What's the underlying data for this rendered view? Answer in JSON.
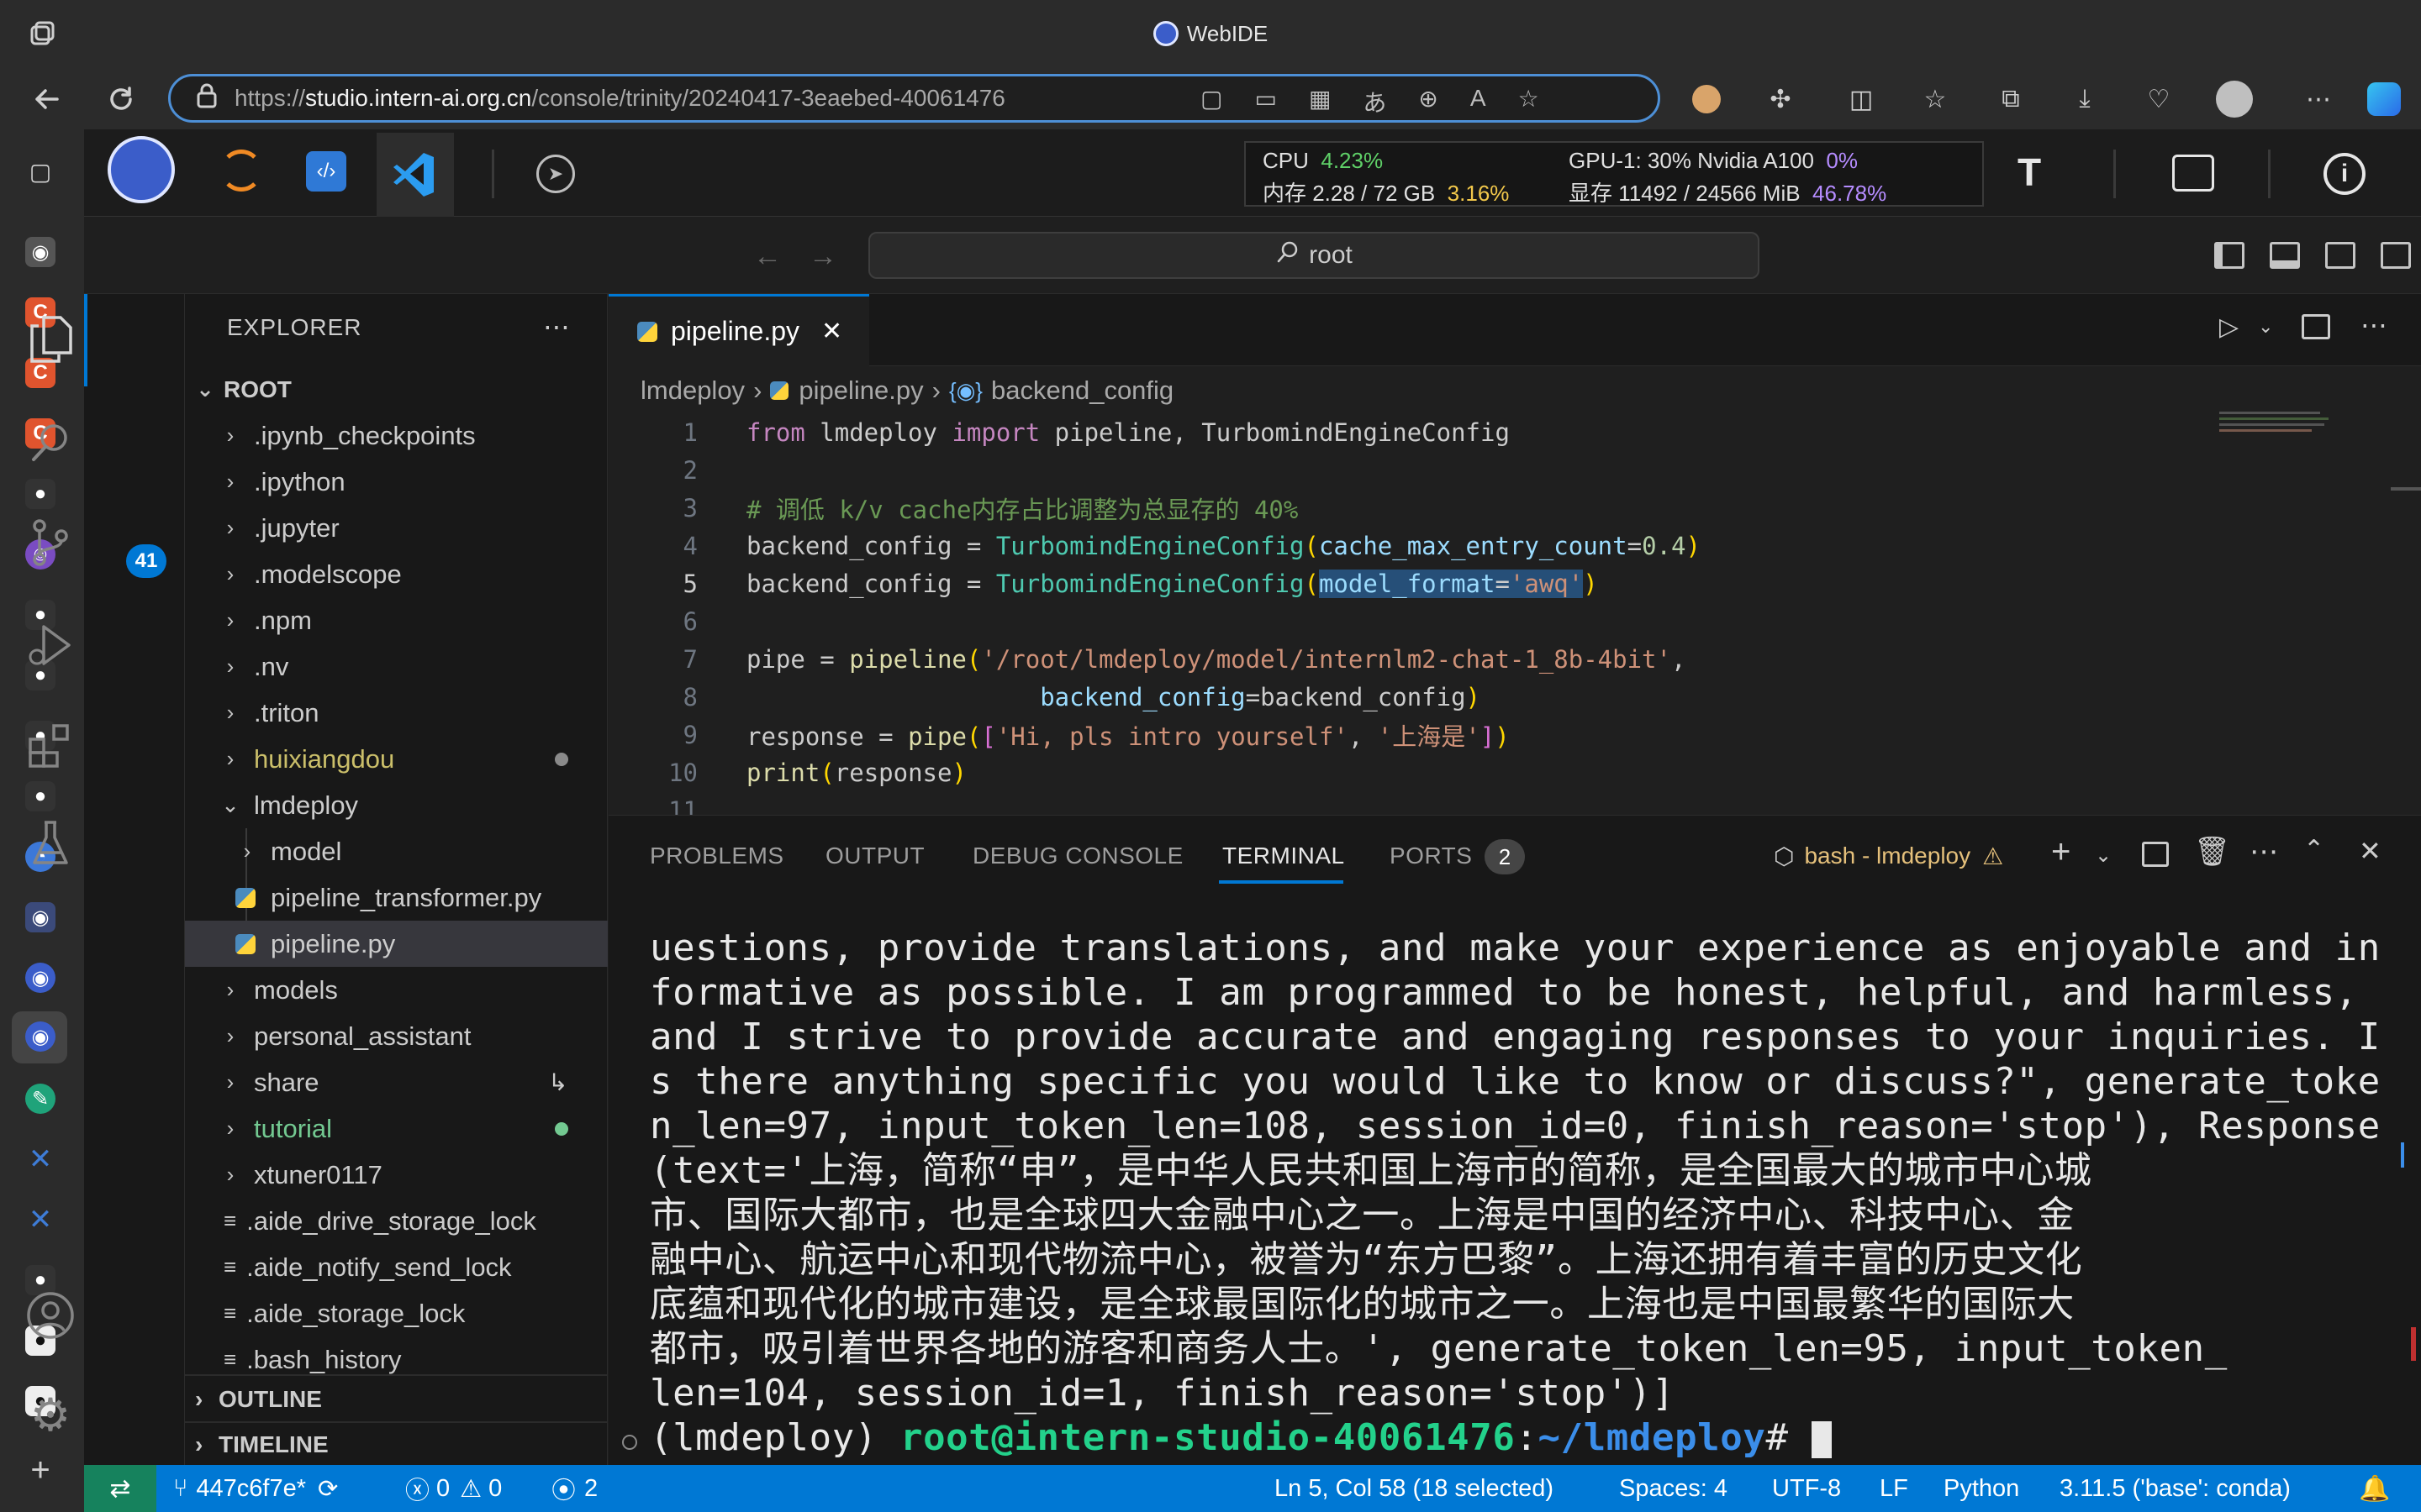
{
  "browser": {
    "window_title": "WebIDE",
    "url_prefix": "https://",
    "url_domain": "studio.intern-ai.org.cn",
    "url_path": "/console/trinity/20240417-3eaebed-40061476"
  },
  "stats": {
    "cpu_label": "CPU",
    "cpu_value": "4.23%",
    "mem_label": "内存 2.28 / 72 GB",
    "mem_value": "3.16%",
    "gpu_label": "GPU-1: 30% Nvidia A100",
    "gpu_value": "0%",
    "vram_label": "显存 11492 / 24566 MiB",
    "vram_value": "46.78%"
  },
  "vscode": {
    "command_center": "root",
    "explorer_title": "EXPLORER",
    "scm_badge": "41",
    "tree": [
      {
        "label": "ROOT",
        "kind": "root"
      },
      {
        "label": ".ipynb_checkpoints",
        "kind": "folder"
      },
      {
        "label": ".ipython",
        "kind": "folder"
      },
      {
        "label": ".jupyter",
        "kind": "folder"
      },
      {
        "label": ".modelscope",
        "kind": "folder"
      },
      {
        "label": ".npm",
        "kind": "folder"
      },
      {
        "label": ".nv",
        "kind": "folder"
      },
      {
        "label": ".triton",
        "kind": "folder"
      },
      {
        "label": "huixiangdou",
        "kind": "folder"
      },
      {
        "label": "lmdeploy",
        "kind": "folder-open"
      },
      {
        "label": "model",
        "kind": "subfolder"
      },
      {
        "label": "pipeline_transformer.py",
        "kind": "pyfile"
      },
      {
        "label": "pipeline.py",
        "kind": "pyfile"
      },
      {
        "label": "models",
        "kind": "folder"
      },
      {
        "label": "personal_assistant",
        "kind": "folder"
      },
      {
        "label": "share",
        "kind": "folder"
      },
      {
        "label": "tutorial",
        "kind": "folder"
      },
      {
        "label": "xtuner0117",
        "kind": "folder"
      },
      {
        "label": ".aide_drive_storage_lock",
        "kind": "file"
      },
      {
        "label": ".aide_notify_send_lock",
        "kind": "file"
      },
      {
        "label": ".aide_storage_lock",
        "kind": "file"
      },
      {
        "label": ".bash_history",
        "kind": "file"
      }
    ],
    "outline": "OUTLINE",
    "timeline": "TIMELINE",
    "tab": "pipeline.py",
    "crumbs": [
      "lmdeploy",
      "pipeline.py",
      "backend_config"
    ],
    "line_numbers": [
      "1",
      "2",
      "3",
      "4",
      "5",
      "6",
      "7",
      "8",
      "9",
      "10",
      "11"
    ],
    "panel_tabs": [
      "PROBLEMS",
      "OUTPUT",
      "DEBUG CONSOLE",
      "TERMINAL",
      "PORTS"
    ],
    "ports_badge": "2",
    "terminal_name": "bash - lmdeploy",
    "terminal_lines": [
      "uestions, provide translations, and make your experience as enjoyable and in",
      "formative as possible. I am programmed to be honest, helpful, and harmless,",
      "and I strive to provide accurate and engaging responses to your inquiries. I",
      "s there anything specific you would like to know or discuss?\", generate_toke",
      "n_len=97, input_token_len=108, session_id=0, finish_reason='stop'), Response",
      "(text='上海，简称“申”，是中华人民共和国上海市的简称，是全国最大的城市中心城",
      "市、国际大都市，也是全球四大金融中心之一。上海是中国的经济中心、科技中心、金",
      "融中心、航运中心和现代物流中心，被誉为“东方巴黎”。上海还拥有着丰富的历史文化",
      "底蕴和现代化的城市建设，是全球最国际化的城市之一。上海也是中国最繁华的国际大",
      "都市，吸引着世界各地的游客和商务人士。', generate_token_len=95, input_token_",
      "len=104, session_id=1, finish_reason='stop')]"
    ],
    "prompt_env": "(lmdeploy) ",
    "prompt_user": "root@intern-studio-40061476",
    "prompt_sep": ":",
    "prompt_path": "~/lmdeploy",
    "prompt_end": "# "
  },
  "status": {
    "branch": "447c6f7e*",
    "errors": "0",
    "warnings": "0",
    "ports": "2",
    "cursor": "Ln 5, Col 58 (18 selected)",
    "spaces": "Spaces: 4",
    "encoding": "UTF-8",
    "eol": "LF",
    "language": "Python",
    "interpreter": "3.11.5 ('base': conda)"
  }
}
